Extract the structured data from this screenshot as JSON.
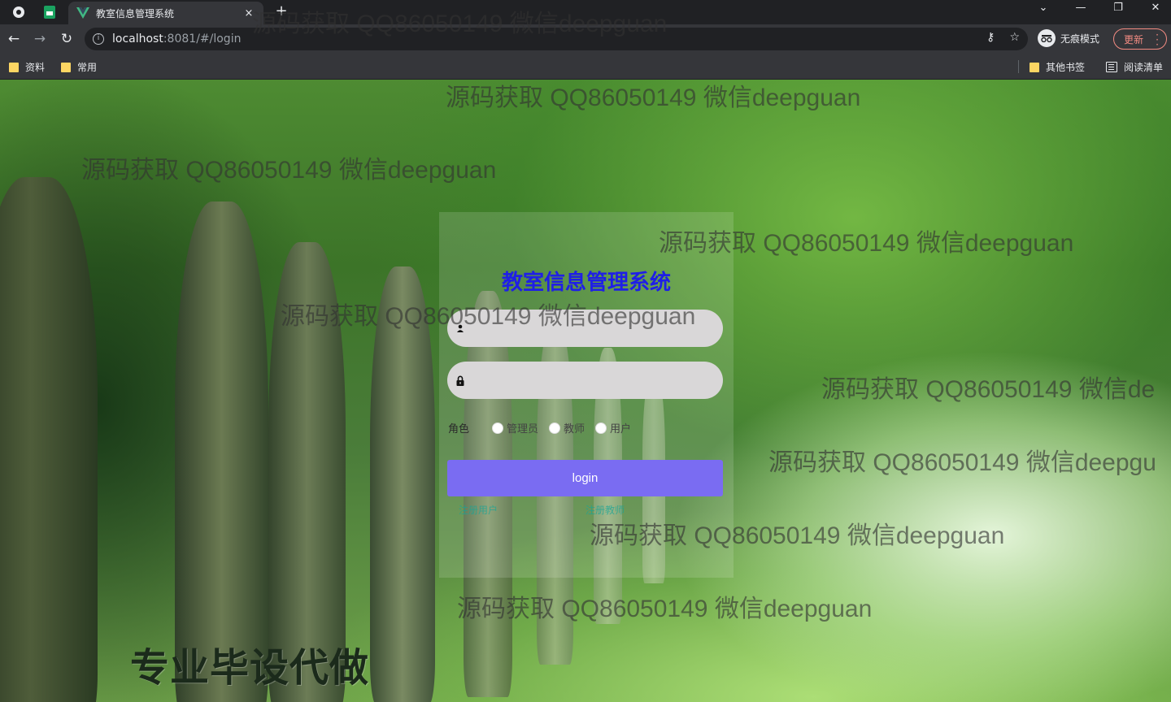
{
  "browser": {
    "tab": {
      "title": "教室信息管理系统",
      "close": "×"
    },
    "new_tab": "+",
    "window_controls": {
      "dropdown": "⌄",
      "minimize": "—",
      "restore": "❐",
      "close": "✕"
    },
    "nav": {
      "back": "←",
      "forward": "→",
      "reload": "↻"
    },
    "address": {
      "host": "localhost",
      "path": ":8081/#/login"
    },
    "incognito_label": "无痕模式",
    "update_label": "更新",
    "bookmarks": {
      "left": [
        "资料",
        "常用"
      ],
      "other": "其他书签",
      "reading_list": "阅读清单"
    }
  },
  "login": {
    "title": "教室信息管理系统",
    "username_value": "",
    "password_value": "",
    "role_label": "角色",
    "roles": [
      "管理员",
      "教师",
      "用户"
    ],
    "submit": "login",
    "links": [
      "注册用户",
      "注册教师"
    ]
  },
  "overlay": {
    "watermark": "源码获取 QQ86050149 微信deepguan",
    "watermark_cut": "源码获取 QQ86050149 微信de",
    "watermark_cut2": "源码获取 QQ86050149 微信deepgu",
    "background_caption": "专业毕设代做"
  }
}
